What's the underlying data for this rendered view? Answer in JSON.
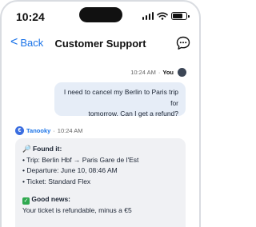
{
  "status_bar": {
    "time": "10:24",
    "battery_level": 0.8
  },
  "header": {
    "back_label": "Back",
    "back_chevron": "<",
    "title": "Customer Support"
  },
  "messages": {
    "user": {
      "time": "10:24 AM",
      "sep": "·",
      "author": "You",
      "line1": "I need to cancel my Berlin to Paris trip for",
      "line2": "tomorrow. Can I get a refund?"
    },
    "bot": {
      "logo": "€",
      "name": "Tanooky",
      "sep": "·",
      "time": "10:24 AM",
      "found_icon": "🔎",
      "found_title": "Found it:",
      "trip": "• Trip: Berlin Hbf → Paris Gare de l'Est",
      "departure": "• Departure: June 10, 08:46 AM",
      "ticket": "• Ticket: Standard Flex",
      "good_news_icon": "✓",
      "good_news_title": "Good news:",
      "refund": "Your ticket is refundable, minus a €5"
    }
  }
}
